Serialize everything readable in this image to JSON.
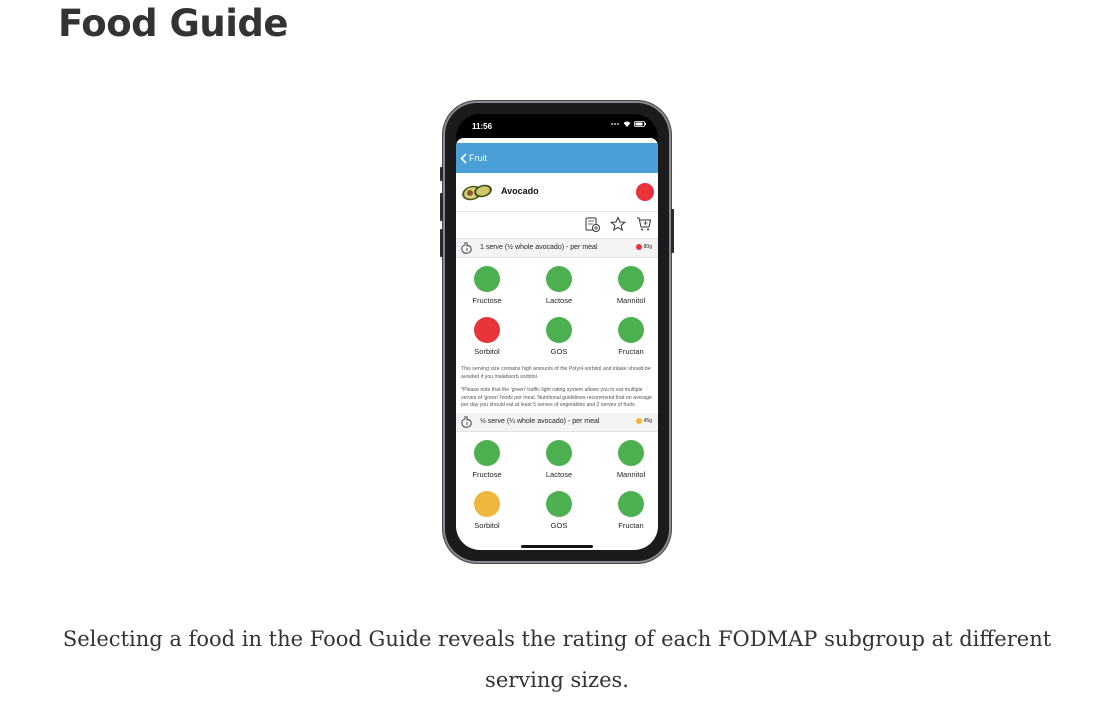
{
  "page": {
    "title": "Food Guide",
    "caption": "Selecting a food in the Food Guide reveals the rating of each FODMAP subgroup at different serving sizes."
  },
  "phone": {
    "status_time": "11:56",
    "nav": {
      "back_label": "Fruit"
    },
    "food": {
      "name": "Avocado",
      "rating_color": "#e8333a"
    },
    "actions": [
      "add-note-icon",
      "star-icon",
      "add-to-cart-icon"
    ],
    "serves": [
      {
        "label": "1 serve (½ whole avocado) - per meal",
        "weight": "80g",
        "weight_color": "#e8333a",
        "items": [
          {
            "name": "Fructose",
            "color": "#4caf50"
          },
          {
            "name": "Lactose",
            "color": "#4caf50"
          },
          {
            "name": "Mannitol",
            "color": "#4caf50"
          },
          {
            "name": "Sorbitol",
            "color": "#e8333a"
          },
          {
            "name": "GOS",
            "color": "#4caf50"
          },
          {
            "name": "Fructan",
            "color": "#4caf50"
          }
        ],
        "note1": "This serving size contains high amounts of the Polyol-sorbitol and intake should be avoided if you malabsorb sorbitol.",
        "note2": "*Please note that the 'green' traffic light rating system allows you to eat multiple serves of 'green' foods per meal. Nutritional guidelines recommend that on average per day you should eat at least 5 serves of vegetables and 2 serves of fruits."
      },
      {
        "label": "½ serve (¼ whole avocado) - per meal",
        "weight": "45g",
        "weight_color": "#f0b53c",
        "items": [
          {
            "name": "Fructose",
            "color": "#4caf50"
          },
          {
            "name": "Lactose",
            "color": "#4caf50"
          },
          {
            "name": "Mannitol",
            "color": "#4caf50"
          },
          {
            "name": "Sorbitol",
            "color": "#f0b53c"
          },
          {
            "name": "GOS",
            "color": "#4caf50"
          },
          {
            "name": "Fructan",
            "color": "#4caf50"
          }
        ]
      }
    ]
  }
}
